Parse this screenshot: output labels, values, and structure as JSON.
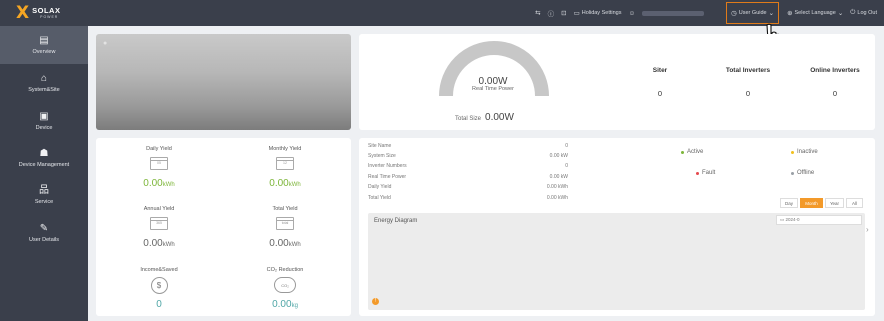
{
  "brand": {
    "mark": "X",
    "name": "SOLAX",
    "sub": "POWER"
  },
  "topbar": {
    "holiday": "Holiday Settings",
    "user_guide": "User Guide",
    "language": "Select Language",
    "logout": "Log Out",
    "accent_color": "#e07b1a"
  },
  "sidebar": {
    "items": [
      {
        "label": "Overview",
        "icon": "document-icon",
        "glyph": "▤"
      },
      {
        "label": "System&Site",
        "icon": "home-icon",
        "glyph": "⌂"
      },
      {
        "label": "Device",
        "icon": "device-icon",
        "glyph": "▣"
      },
      {
        "label": "Device Management",
        "icon": "people-icon",
        "glyph": "☗"
      },
      {
        "label": "Service",
        "icon": "service-icon",
        "glyph": "品"
      },
      {
        "label": "User Details",
        "icon": "pen-icon",
        "glyph": "✎"
      }
    ]
  },
  "power": {
    "value": "0.00W",
    "label": "Real Time Power",
    "total_size_label": "Total Size",
    "total_size_value": "0.00W"
  },
  "stats": [
    {
      "label": "Siter",
      "value": "0"
    },
    {
      "label": "Total Inverters",
      "value": "0"
    },
    {
      "label": "Online Inverters",
      "value": "0"
    }
  ],
  "yields": [
    {
      "title": "Daily Yield",
      "icon_text": "05",
      "value": "0.00",
      "unit": "kWh",
      "style": "green"
    },
    {
      "title": "Monthly Yield",
      "icon_text": "12",
      "value": "0.00",
      "unit": "kWh",
      "style": "green"
    },
    {
      "title": "Annual Yield",
      "icon_text": "365",
      "value": "0.00",
      "unit": "kWh",
      "style": "grey"
    },
    {
      "title": "Total Yield",
      "icon_text": "total",
      "value": "0.00",
      "unit": "kWh",
      "style": "grey"
    },
    {
      "title": "Income&Saved",
      "icon_text": "$",
      "value": "0",
      "unit": "",
      "style": "teal"
    },
    {
      "title": "CO₂ Reduction",
      "icon_text": "CO₂",
      "value": "0.00",
      "unit": "kg",
      "style": "teal"
    }
  ],
  "info": [
    {
      "label": "Site Name",
      "value": "0"
    },
    {
      "label": "System Size",
      "value": "0.00 kW"
    },
    {
      "label": "Inverter Numbers",
      "value": "0"
    },
    {
      "label": "Real Time Power",
      "value": "0.00 kW"
    },
    {
      "label": "Daily Yield",
      "value": "0.00 kWh"
    },
    {
      "label": "Total Yield",
      "value": "0.00 kWh"
    }
  ],
  "statuses": [
    {
      "label": "Active",
      "color": "#7db63a"
    },
    {
      "label": "Inactive",
      "color": "#f2c01e"
    },
    {
      "label": "Fault",
      "color": "#e5484d"
    },
    {
      "label": "Offline",
      "color": "#9aa0a6"
    }
  ],
  "periods": [
    "Day",
    "Month",
    "Year",
    "All"
  ],
  "energy": {
    "title": "Energy Diagram",
    "date": "2024-0"
  }
}
